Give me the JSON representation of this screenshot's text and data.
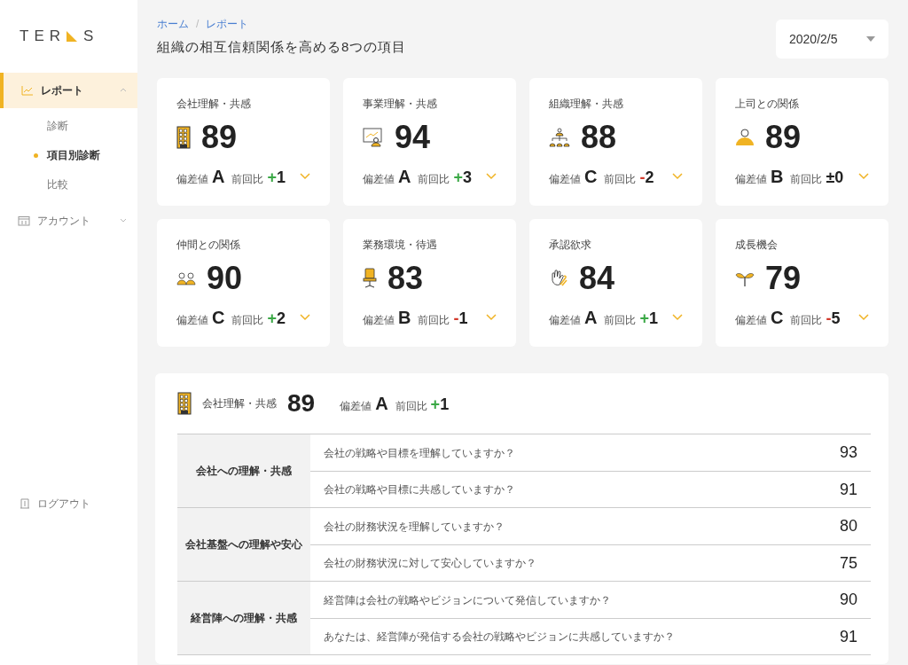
{
  "logo": {
    "left": "TER",
    "right": "S"
  },
  "sidebar": {
    "items": [
      {
        "label": "レポート",
        "kind": "chart",
        "selected": true,
        "expanded": true,
        "children": [
          {
            "label": "診断",
            "selected": false
          },
          {
            "label": "項目別診断",
            "selected": true
          },
          {
            "label": "比較",
            "selected": false
          }
        ]
      },
      {
        "label": "アカウント",
        "kind": "calendar",
        "selected": false,
        "expanded": false
      }
    ],
    "logout": {
      "label": "ログアウト"
    }
  },
  "breadcrumb": [
    "ホーム",
    "/",
    "レポート"
  ],
  "title": "組織の相互信頼関係を高める8つの項目",
  "date_select": {
    "value": "2020/2/5"
  },
  "cards": [
    {
      "title": "会社理解・共感",
      "kind": "building",
      "score": "89",
      "grade_label": "偏差値",
      "grade": "A",
      "delta_label": "前回比",
      "delta": {
        "sign": "+",
        "value": "1",
        "color": "#3aa845"
      }
    },
    {
      "title": "事業理解・共感",
      "kind": "presentation",
      "score": "94",
      "grade_label": "偏差値",
      "grade": "A",
      "delta_label": "前回比",
      "delta": {
        "sign": "+",
        "value": "3",
        "color": "#3aa845"
      }
    },
    {
      "title": "組織理解・共感",
      "kind": "org",
      "score": "88",
      "grade_label": "偏差値",
      "grade": "C",
      "delta_label": "前回比",
      "delta": {
        "sign": "-",
        "value": "2",
        "color": "#d33a2c"
      }
    },
    {
      "title": "上司との関係",
      "kind": "person",
      "score": "89",
      "grade_label": "偏差値",
      "grade": "B",
      "delta_label": "前回比",
      "delta": {
        "sign": "±",
        "value": "0",
        "color": "#222222"
      }
    },
    {
      "title": "仲間との関係",
      "kind": "people",
      "score": "90",
      "grade_label": "偏差値",
      "grade": "C",
      "delta_label": "前回比",
      "delta": {
        "sign": "+",
        "value": "2",
        "color": "#3aa845"
      }
    },
    {
      "title": "業務環境・待遇",
      "kind": "chair",
      "score": "83",
      "grade_label": "偏差値",
      "grade": "B",
      "delta_label": "前回比",
      "delta": {
        "sign": "-",
        "value": "1",
        "color": "#d33a2c"
      }
    },
    {
      "title": "承認欲求",
      "kind": "hands",
      "score": "84",
      "grade_label": "偏差値",
      "grade": "A",
      "delta_label": "前回比",
      "delta": {
        "sign": "+",
        "value": "1",
        "color": "#3aa845"
      }
    },
    {
      "title": "成長機会",
      "kind": "sprout",
      "score": "79",
      "grade_label": "偏差値",
      "grade": "C",
      "delta_label": "前回比",
      "delta": {
        "sign": "-",
        "value": "5",
        "color": "#d33a2c"
      }
    }
  ],
  "detail": {
    "title": "会社理解・共感",
    "kind": "building",
    "score": "89",
    "grade_label": "偏差値",
    "grade": "A",
    "delta_label": "前回比",
    "delta": {
      "sign": "+",
      "value": "1",
      "color": "#3aa845"
    },
    "groups": [
      {
        "label": "会社への理解・共感",
        "rows": [
          {
            "question": "会社の戦略や目標を理解していますか？",
            "score": "93"
          },
          {
            "question": "会社の戦略や目標に共感していますか？",
            "score": "91"
          }
        ]
      },
      {
        "label": "会社基盤への理解や安心",
        "rows": [
          {
            "question": "会社の財務状況を理解していますか？",
            "score": "80"
          },
          {
            "question": "会社の財務状況に対して安心していますか？",
            "score": "75"
          }
        ]
      },
      {
        "label": "経営陣への理解・共感",
        "rows": [
          {
            "question": "経営陣は会社の戦略やビジョンについて発信していますか？",
            "score": "90"
          },
          {
            "question": "あなたは、経営陣が発信する会社の戦略やビジョンに共感していますか？",
            "score": "91"
          }
        ]
      }
    ]
  }
}
